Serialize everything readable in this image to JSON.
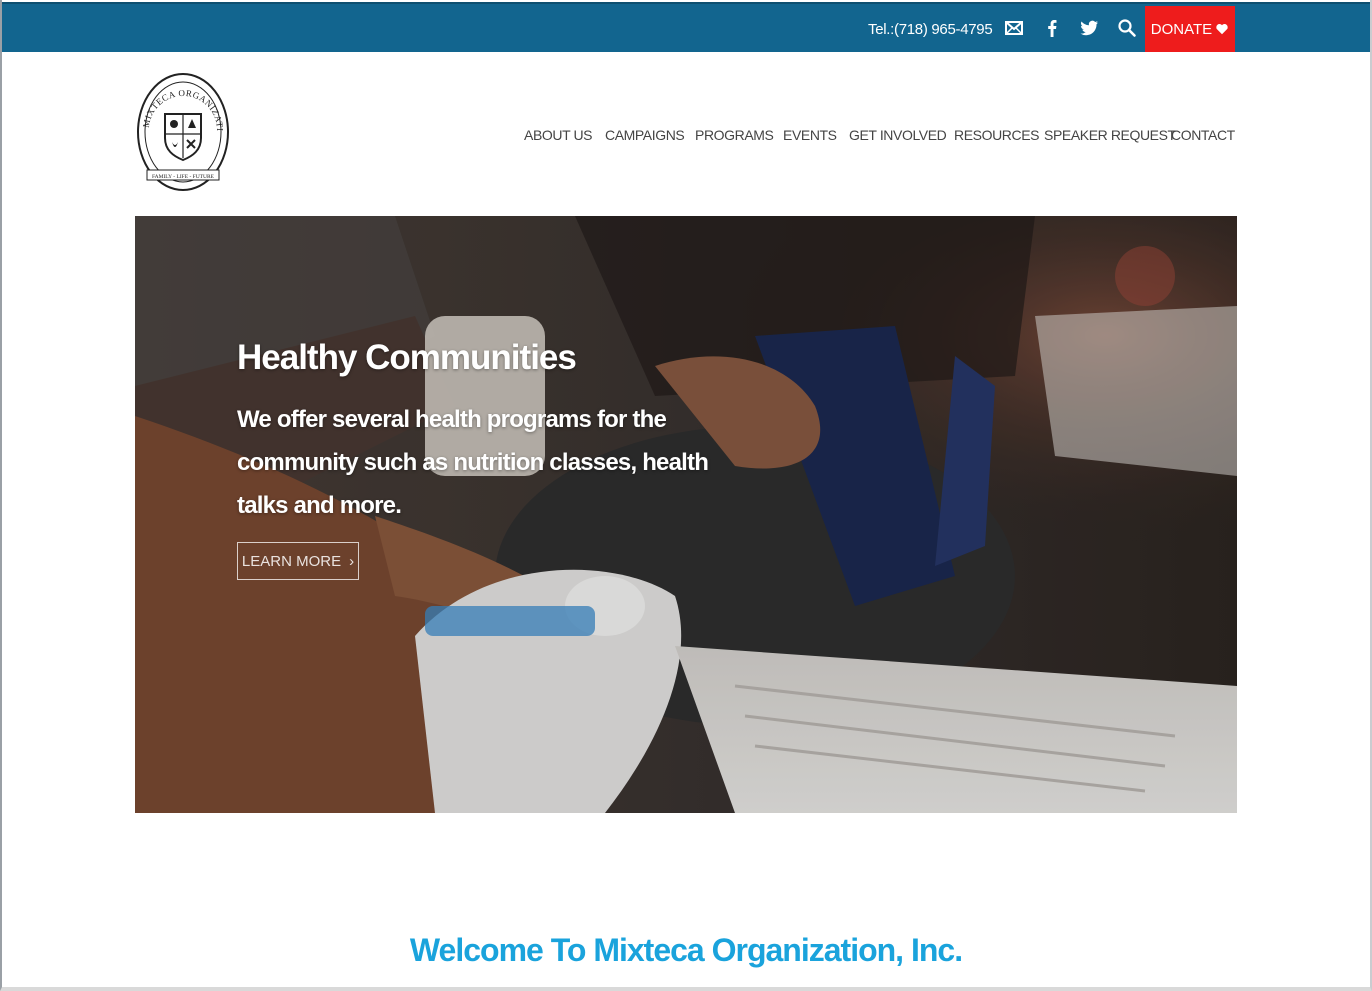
{
  "topbar": {
    "tel": "Tel.:(718) 965-4795",
    "icons": [
      "envelope-icon",
      "facebook-icon",
      "twitter-icon",
      "search-icon"
    ],
    "donate_label": "DONATE",
    "bg_color": "#12658f",
    "donate_color": "#ee1c1c"
  },
  "logo": {
    "top_text": "MIXTECA ORGANIZATION, INC",
    "motto": "FAMILY - LIFE - FUTURE"
  },
  "nav": {
    "items": [
      "ABOUT US",
      "CAMPAIGNS",
      "PROGRAMS",
      "EVENTS",
      "GET INVOLVED",
      "RESOURCES",
      "SPEAKER REQUEST",
      "CONTACT"
    ]
  },
  "hero": {
    "title": "Healthy Communities",
    "text": "We offer several health programs for the community such as nutrition classes, health talks and more.",
    "button_label": "LEARN MORE"
  },
  "welcome": {
    "heading": "Welcome To Mixteca Organization, Inc.",
    "color": "#1aa3dc"
  }
}
